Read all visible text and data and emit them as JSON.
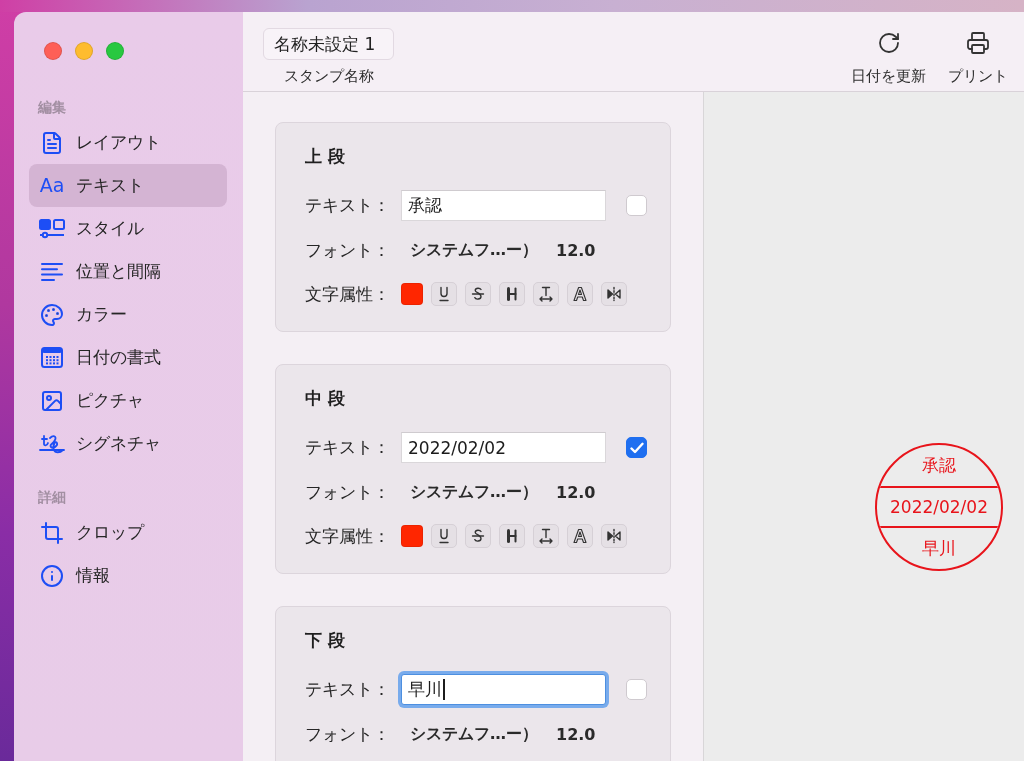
{
  "sidebar": {
    "sections": [
      {
        "title": "編集",
        "items": [
          {
            "label": "レイアウト",
            "selected": false
          },
          {
            "label": "テキスト",
            "glyph": "Aa",
            "selected": true
          },
          {
            "label": "スタイル",
            "selected": false
          },
          {
            "label": "位置と間隔",
            "selected": false
          },
          {
            "label": "カラー",
            "selected": false
          },
          {
            "label": "日付の書式",
            "selected": false
          },
          {
            "label": "ピクチャ",
            "selected": false
          },
          {
            "label": "シグネチャ",
            "selected": false
          }
        ]
      },
      {
        "title": "詳細",
        "items": [
          {
            "label": "クロップ",
            "selected": false
          },
          {
            "label": "情報",
            "selected": false
          }
        ]
      }
    ]
  },
  "toolbar": {
    "name_field": {
      "value": "名称未設定 1",
      "label": "スタンプ名称"
    },
    "actions": [
      {
        "label": "日付を更新"
      },
      {
        "label": "プリント"
      }
    ]
  },
  "sections": [
    {
      "title": "上 段",
      "text_label": "テキスト：",
      "text_value": "承認",
      "checked": false,
      "focused": false,
      "font_label": "フォント：",
      "font_name": "システムフ…ー）",
      "font_size": "12.0",
      "attributes_label": "文字属性：",
      "color": "#ff2600"
    },
    {
      "title": "中 段",
      "text_label": "テキスト：",
      "text_value": "2022/02/02",
      "checked": true,
      "focused": false,
      "font_label": "フォント：",
      "font_name": "システムフ…ー）",
      "font_size": "12.0",
      "attributes_label": "文字属性：",
      "color": "#ff2600"
    },
    {
      "title": "下 段",
      "text_label": "テキスト：",
      "text_value": "早川",
      "checked": false,
      "focused": true,
      "font_label": "フォント：",
      "font_name": "システムフ…ー）",
      "font_size": "12.0"
    }
  ],
  "preview": {
    "lines": [
      "承認",
      "2022/02/02",
      "早川"
    ]
  }
}
